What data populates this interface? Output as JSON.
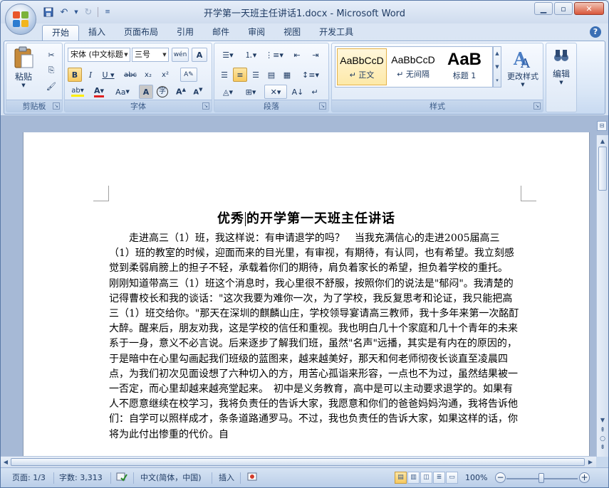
{
  "window": {
    "title": "开学第一天班主任讲话1.docx - Microsoft Word"
  },
  "qat": {
    "icons": [
      "save-icon",
      "undo-icon",
      "redo-icon",
      "customize-icon"
    ]
  },
  "tabs": [
    "开始",
    "插入",
    "页面布局",
    "引用",
    "邮件",
    "审阅",
    "视图",
    "开发工具"
  ],
  "ribbon": {
    "clipboard": {
      "label": "剪贴板",
      "paste": "粘贴"
    },
    "font": {
      "label": "字体",
      "font_name": "宋体 (中文标题",
      "font_size": "三号",
      "change_case": "Aa"
    },
    "paragraph": {
      "label": "段落"
    },
    "styles": {
      "label": "样式",
      "items": [
        {
          "sample": "AaBbCcD",
          "name": "↵ 正文"
        },
        {
          "sample": "AaBbCcD",
          "name": "↵ 无间隔"
        },
        {
          "sample": "AaB",
          "name": "标题 1"
        }
      ],
      "change_styles": "更改样式"
    },
    "editing": {
      "label": "编辑"
    }
  },
  "document": {
    "title_part1": "优秀",
    "title_part2": "的开学第一天班主任讲话",
    "body": "走进高三（1）班，我这样说：有申请退学的吗？　当我充满信心的走进2005届高三（1）班的教室的时候，迎面而来的目光里，有审视，有期待，有认同，也有希望。我立刻感觉到柔弱肩膀上的担子不轻，承载着你们的期待，肩负着家长的希望，担负着学校的重托。　刚刚知道带高三（1）班这个消息时，我心里很不舒服，按照你们的说法是\"郁闷\"。我清楚的记得曹校长和我的谈话：\"这次我要为难你一次，为了学校，我反复思考和论证，我只能把高三（1）班交给你。\"那天在深圳的麒麟山庄，学校领导宴请高三教师，我十多年来第一次酩酊大醉。醒来后，朋友劝我，这是学校的信任和重视。我也明白几十个家庭和几十个青年的未来系于一身，意义不必言说。后来逐步了解我们班，虽然\"名声\"远播，其实是有内在的原因的，于是暗中在心里勾画起我们班级的蓝图来，越来越美好，那天和何老师彻夜长谈直至凌晨四点，为我们初次见面设想了六种切入的方，用苦心孤诣来形容，一点也不为过，虽然结果被一一否定，而心里却越来越亮堂起来。　初中是义务教育，高中是可以主动要求退学的。如果有人不愿意继续在校学习，我将负责任的告诉大家，我愿意和你们的爸爸妈妈沟通，我将告诉他们：自学可以照样成才，条条道路通罗马。不过，我也负责任的告诉大家，如果这样的话，你将为此付出惨重的代价。自"
  },
  "status": {
    "page": "页面: 1/3",
    "words": "字数: 3,313",
    "language": "中文(简体，中国)",
    "mode": "插入",
    "zoom": "100%",
    "zoom_level": 100
  }
}
